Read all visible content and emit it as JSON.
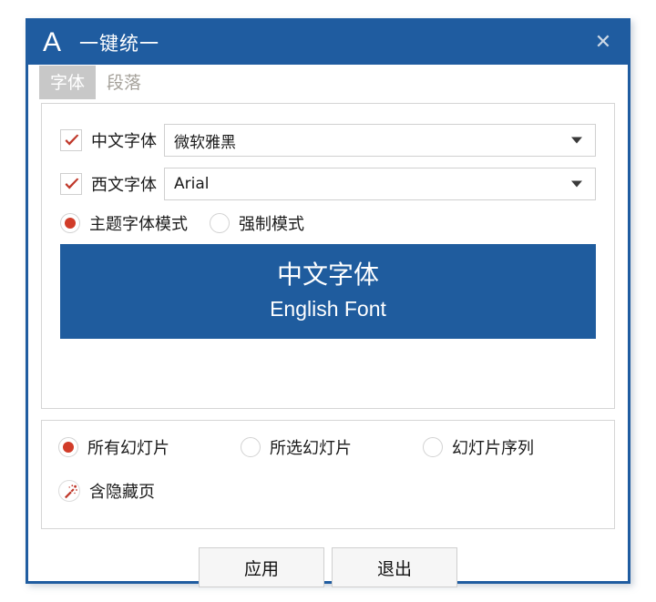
{
  "window": {
    "logo_letter": "A",
    "title": "一键统一",
    "close_label": "✕",
    "accent_color": "#1f5ca0"
  },
  "tabs": [
    {
      "label": "字体",
      "active": true
    },
    {
      "label": "段落",
      "active": false
    }
  ],
  "font_panel": {
    "rows": [
      {
        "checked": true,
        "label": "中文字体",
        "value": "微软雅黑"
      },
      {
        "checked": true,
        "label": "西文字体",
        "value": "Arial"
      }
    ],
    "modes": [
      {
        "label": "主题字体模式",
        "selected": true
      },
      {
        "label": "强制模式",
        "selected": false
      }
    ],
    "preview": {
      "chinese_text": "中文字体",
      "english_text": "English Font",
      "background_color": "#1f5c9e",
      "text_color": "#ffffff"
    }
  },
  "scope_panel": {
    "options": [
      {
        "label": "所有幻灯片",
        "selected": true
      },
      {
        "label": "所选幻灯片",
        "selected": false
      },
      {
        "label": "幻灯片序列",
        "selected": false
      }
    ],
    "hidden_pages": {
      "icon": "magic-wand-icon",
      "label": "含隐藏页"
    }
  },
  "footer": {
    "apply_label": "应用",
    "exit_label": "退出"
  },
  "colors": {
    "check_red": "#c0392b",
    "radio_red": "#d13c29",
    "tab_active_bg": "#c8c8c8",
    "tab_inactive_text": "#a5a19a"
  }
}
